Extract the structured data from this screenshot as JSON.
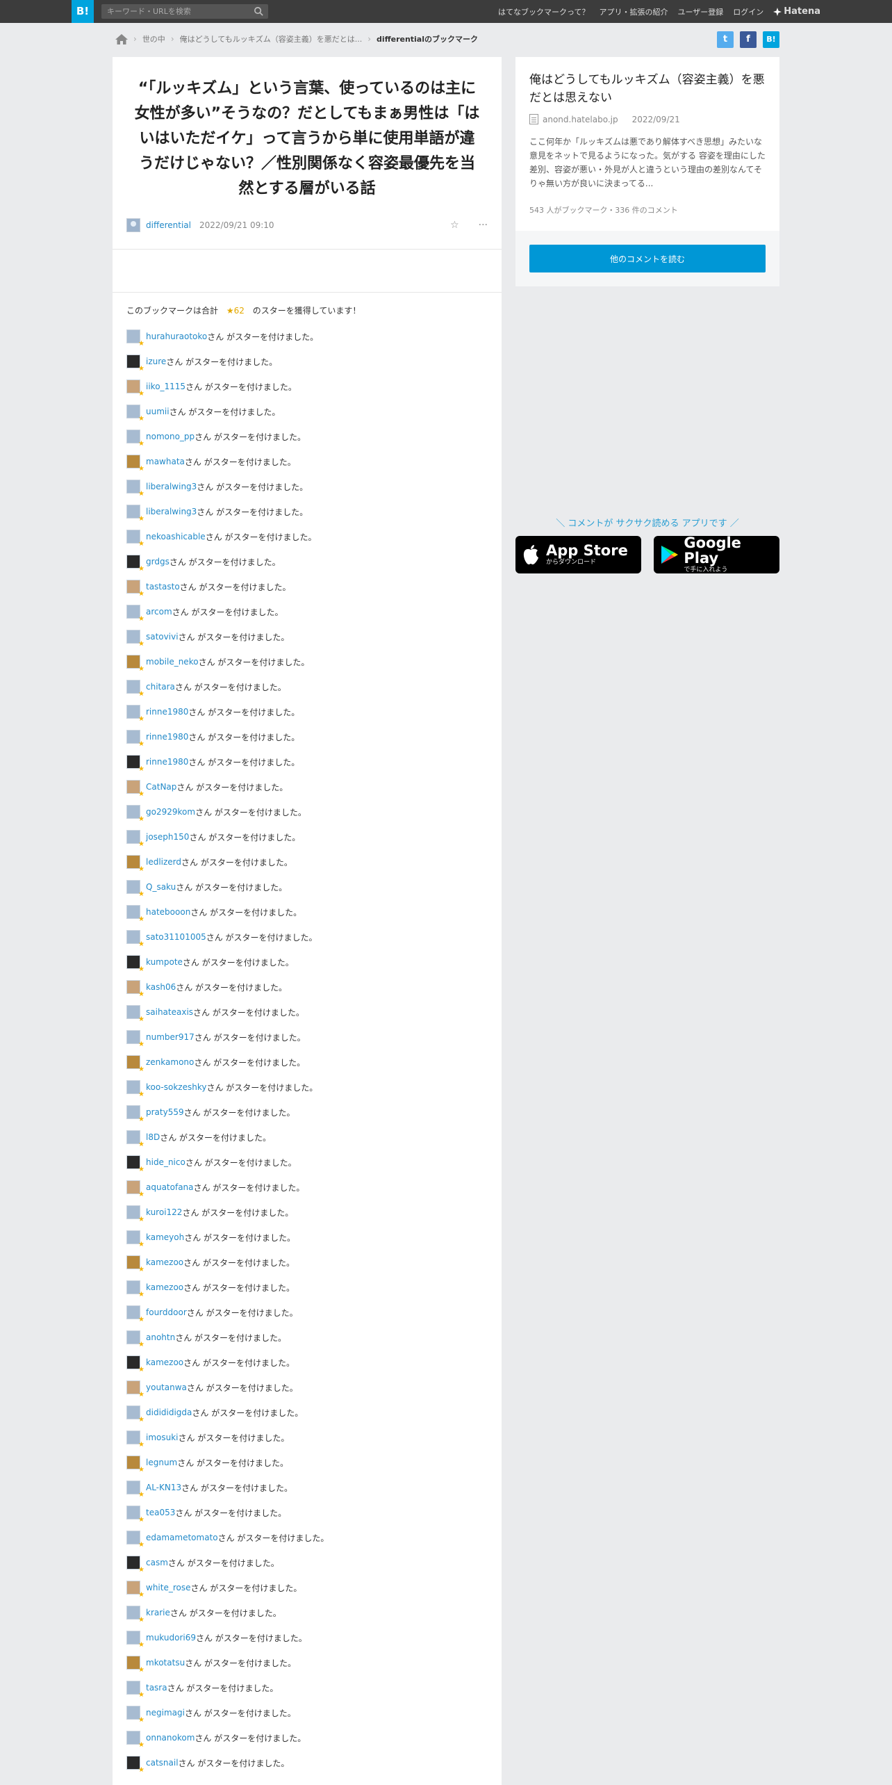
{
  "header": {
    "logo": "B!",
    "search_placeholder": "キーワード・URLを検索",
    "nav": [
      "はてなブックマークって？",
      "アプリ・拡張の紹介",
      "ユーザー登録",
      "ログイン"
    ],
    "brand": "Hatena"
  },
  "breadcrumb": {
    "items": [
      "世の中",
      "俺はどうしてもルッキズム（容姿主義）を悪だとは..."
    ],
    "current": "differentialのブックマーク"
  },
  "share": {
    "twitter": "t",
    "facebook": "f",
    "hatena": "B!"
  },
  "bookmark": {
    "comment": "“「ルッキズム」という言葉、使っているのは主に女性が多い”そうなの？だとしてもまぁ男性は「はいはいただイケ」って言うから単に使用単語が違うだけじゃない？／性別関係なく容姿最優先を当然とする層がいる話",
    "user": "differential",
    "date": "2022/09/21 09:10",
    "star_summary_prefix": "このブックマークは合計",
    "star_count": "★62",
    "star_summary_suffix": "のスターを獲得しています！",
    "star_suffix": "さん がスターを付けました。",
    "star_givers": [
      "hurahuraotoko",
      "izure",
      "iiko_1115",
      "uumii",
      "nomono_pp",
      "mawhata",
      "liberalwing3",
      "liberalwing3",
      "nekoashicable",
      "grdgs",
      "tastasto",
      "arcom",
      "satovivi",
      "mobile_neko",
      "chitara",
      "rinne1980",
      "rinne1980",
      "rinne1980",
      "CatNap",
      "go2929kom",
      "joseph150",
      "ledlizerd",
      "Q_saku",
      "hatebooon",
      "sato31101005",
      "kumpote",
      "kash06",
      "saihateaxis",
      "number917",
      "zenkamono",
      "koo-sokzeshky",
      "praty559",
      "l8D",
      "hide_nico",
      "aquatofana",
      "kuroi122",
      "kameyoh",
      "kamezoo",
      "kamezoo",
      "fourddoor",
      "anohtn",
      "kamezoo",
      "youtanwa",
      "didididigda",
      "imosuki",
      "legnum",
      "AL-KN13",
      "tea053",
      "edamametomato",
      "casm",
      "white_rose",
      "krarie",
      "mukudori69",
      "mkotatsu",
      "tasra",
      "negimagi",
      "onnanokom",
      "catsnail"
    ]
  },
  "entry": {
    "title": "俺はどうしてもルッキズム（容姿主義）を悪だとは思えない",
    "source": "anond.hatelabo.jp",
    "date": "2022/09/21",
    "description": "ここ何年か「ルッキズムは悪であり解体すべき思想」みたいな意見をネットで見るようになった。気がする 容姿を理由にした差別、容姿が悪い・外見が人と違うという理由の差別なんてそりゃ無い方が良いに決まってる...",
    "stats": "543 人がブックマーク・336 件のコメント",
    "more_button": "他のコメントを読む"
  },
  "app_promo": {
    "tagline": "＼ コメントが サクサク読める アプリです ／",
    "appstore_title": "App Store",
    "appstore_sub": "からダウンロード",
    "googleplay_title": "Google Play",
    "googleplay_sub": "で手に入れよう"
  },
  "colors": {
    "accent": "#00a4de",
    "link": "#2289c8",
    "star": "#f5b400",
    "button": "#0097d6"
  }
}
